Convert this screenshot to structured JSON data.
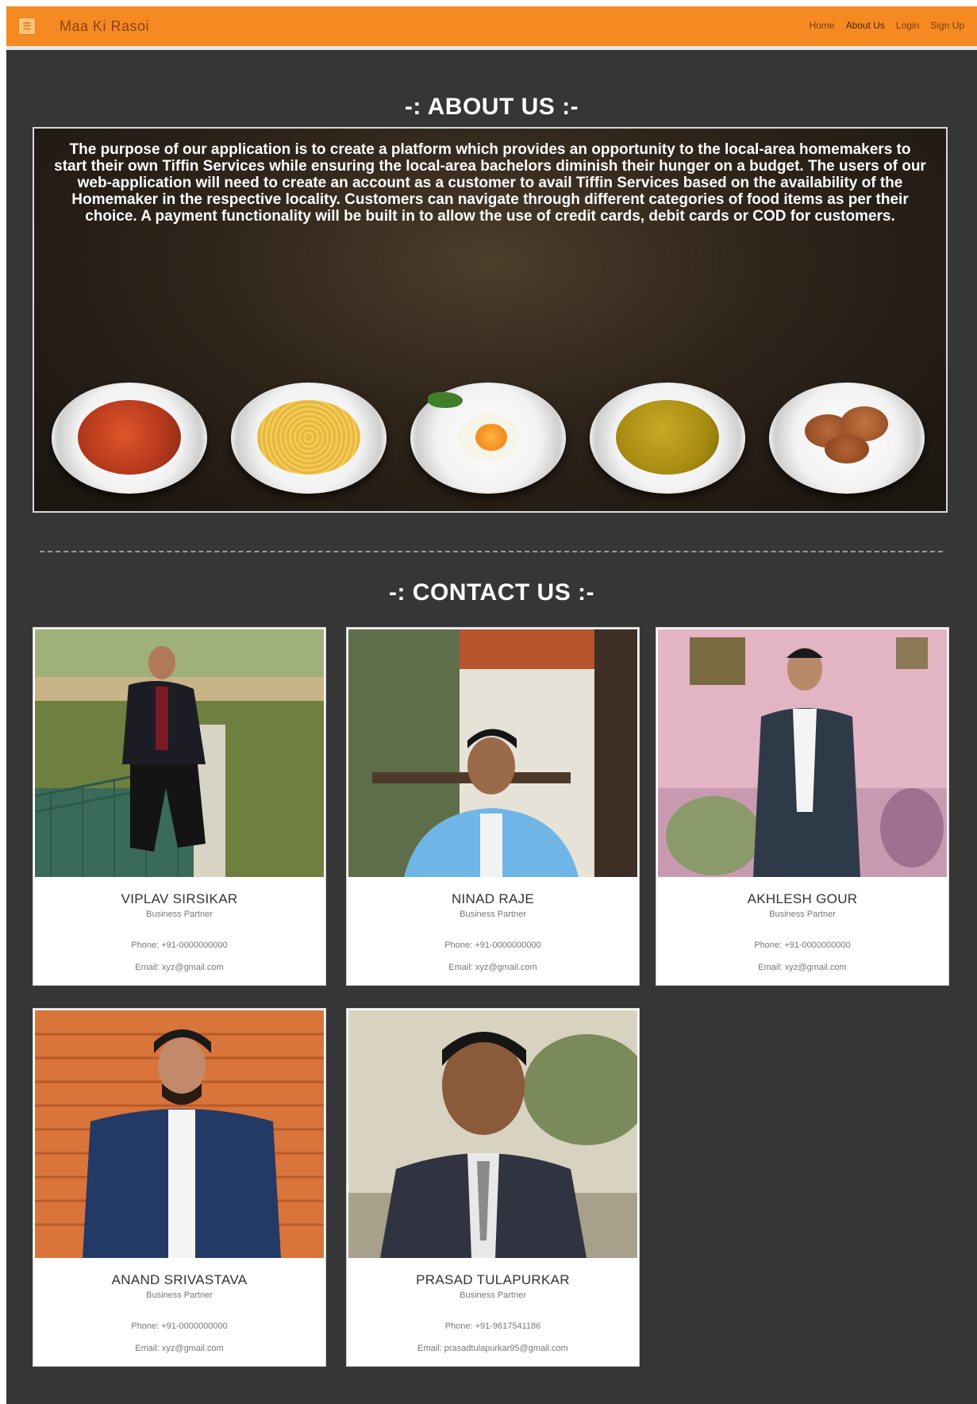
{
  "navbar": {
    "brand": "Maa Ki Rasoi",
    "links": [
      "Home",
      "About Us",
      "Login",
      "Sign Up"
    ]
  },
  "about": {
    "title": "-: ABOUT US :-",
    "text": "The purpose of our application is to create a platform which provides an opportunity to the local-area homemakers to start their own Tiffin Services while ensuring the local-area bachelors diminish their hunger on a budget. The users of our web-application will need to create an account as a customer to avail Tiffin Services based on the availability of the Homemaker in the respective locality. Customers can navigate through different categories of food items as per their choice. A payment functionality will be built in to allow the use of credit cards, debit cards or COD for customers."
  },
  "contact": {
    "title": "-: CONTACT US :-",
    "members": [
      {
        "name": "VIPLAV SIRSIKAR",
        "role": "Business Partner",
        "phone": "Phone: +91-0000000000",
        "email": "Email: xyz@gmail.com"
      },
      {
        "name": "NINAD RAJE",
        "role": "Business Partner",
        "phone": "Phone: +91-0000000000",
        "email": "Email: xyz@gmail.com"
      },
      {
        "name": "AKHLESH GOUR",
        "role": "Business Partner",
        "phone": "Phone: +91-0000000000",
        "email": "Email: xyz@gmail.com"
      },
      {
        "name": "ANAND SRIVASTAVA",
        "role": "Business Partner",
        "phone": "Phone: +91-0000000000",
        "email": "Email: xyz@gmail.com"
      },
      {
        "name": "PRASAD TULAPURKAR",
        "role": "Business Partner",
        "phone": "Phone: +91-9617541186",
        "email": "Email: prasadtulapurkar95@gmail.com"
      }
    ]
  },
  "colors": {
    "navbar": "#f58a22",
    "background": "#363636",
    "card": "#ffffff"
  }
}
